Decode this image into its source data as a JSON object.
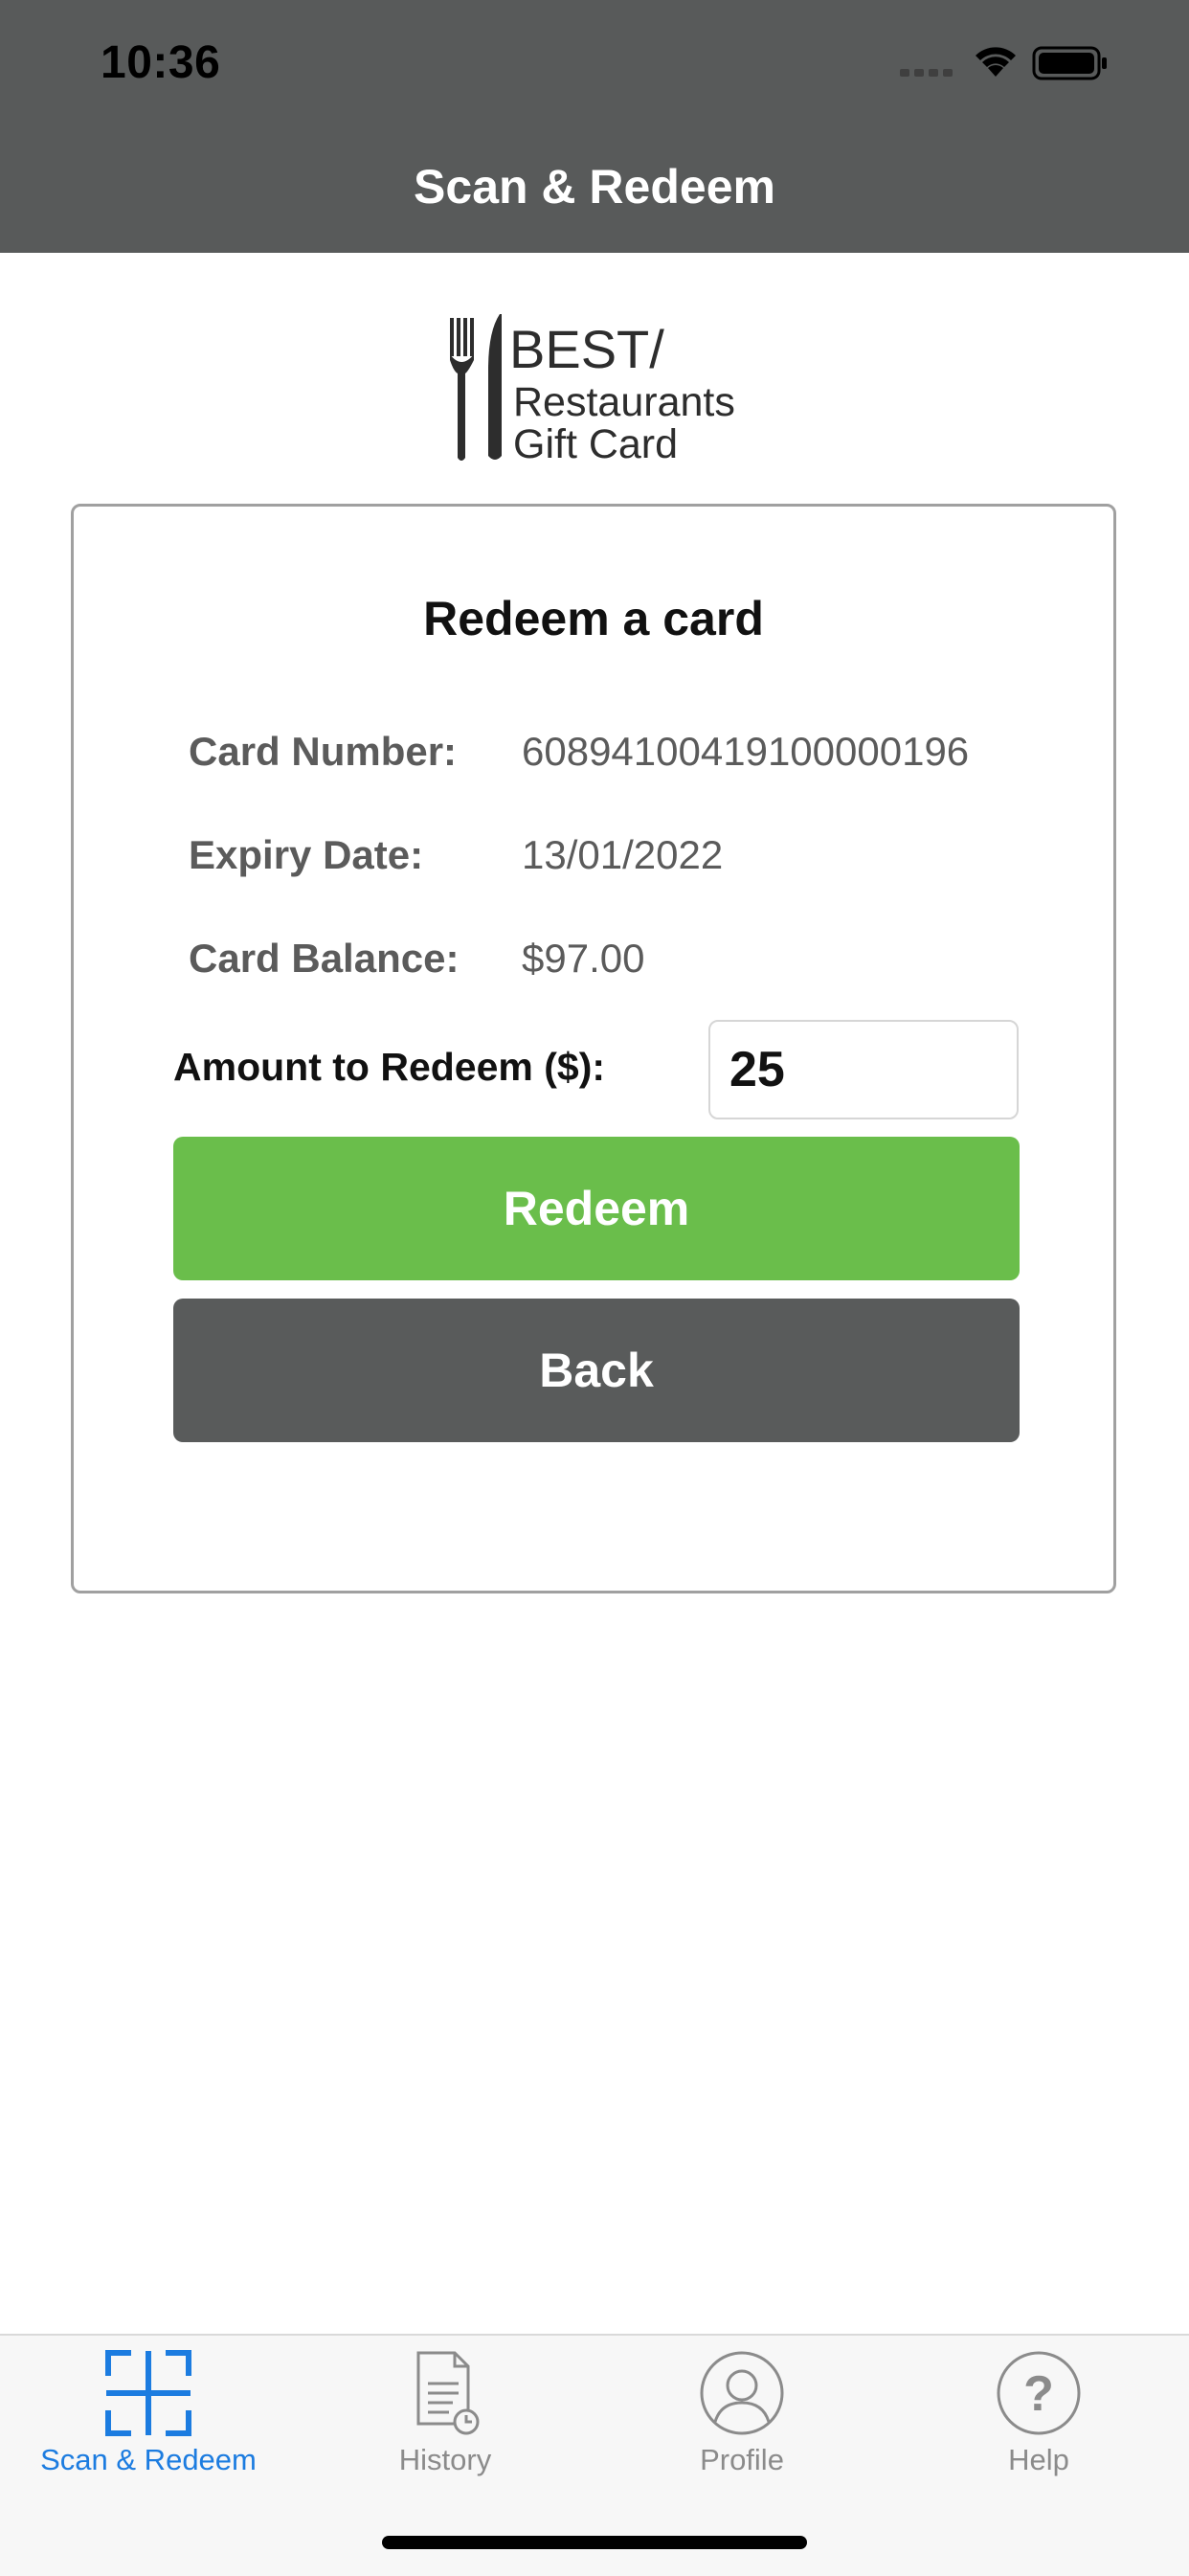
{
  "status_bar": {
    "time": "10:36"
  },
  "nav": {
    "title": "Scan & Redeem"
  },
  "logo": {
    "line1": "BEST/",
    "line2": "Restaurants",
    "line3": "Gift Card"
  },
  "card": {
    "title": "Redeem a card",
    "rows": [
      {
        "label": "Card Number:",
        "value": "60894100419100000196"
      },
      {
        "label": "Expiry Date:",
        "value": "13/01/2022"
      },
      {
        "label": "Card Balance:",
        "value": "$97.00"
      }
    ],
    "amount_label": "Amount to Redeem ($):",
    "amount_value": "25",
    "redeem_label": "Redeem",
    "back_label": "Back"
  },
  "colors": {
    "header": "#585a5a",
    "redeem": "#6abe4b",
    "back": "#595b5b",
    "active_tab": "#1c7ce0"
  },
  "tabbar": {
    "tabs": [
      {
        "label": "Scan & Redeem",
        "icon": "scan-icon",
        "active": true
      },
      {
        "label": "History",
        "icon": "history-icon",
        "active": false
      },
      {
        "label": "Profile",
        "icon": "profile-icon",
        "active": false
      },
      {
        "label": "Help",
        "icon": "help-icon",
        "active": false
      }
    ]
  }
}
